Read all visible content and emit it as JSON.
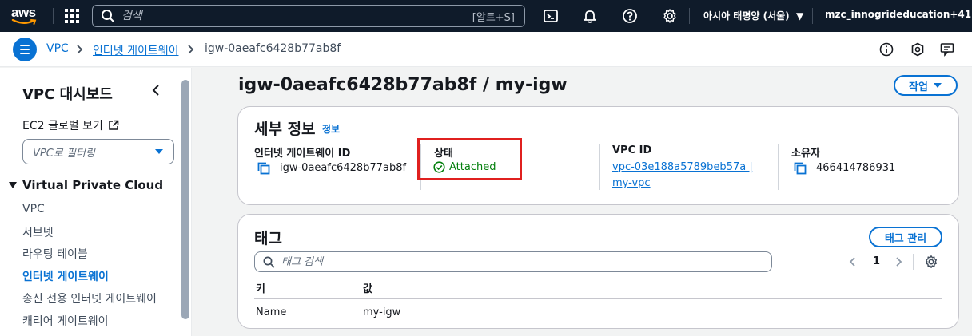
{
  "topnav": {
    "logo": "aws",
    "search_placeholder": "검색",
    "search_shortcut": "[알트+S]",
    "icons": [
      "apps-grid-icon",
      "cloudshell-icon",
      "bell-icon",
      "help-icon",
      "gear-icon"
    ],
    "region": "아시아 태평양 (서울)",
    "account": "mzc_innogrideducation+41"
  },
  "breadcrumb": {
    "items": [
      "VPC",
      "인터넷 게이트웨이",
      "igw-0aeafc6428b77ab8f"
    ],
    "right_icons": [
      "info-circle-icon",
      "hexagon-icon",
      "feedback-icon"
    ]
  },
  "sidebar": {
    "title": "VPC 대시보드",
    "ec2_global_view": "EC2 글로벌 보기",
    "filter_placeholder": "VPC로 필터링",
    "section": "Virtual Private Cloud",
    "items": [
      "VPC",
      "서브넷",
      "라우팅 테이블",
      "인터넷 게이트웨이",
      "송신 전용 인터넷 게이트웨이",
      "캐리어 게이트웨이"
    ],
    "active_item": "인터넷 게이트웨이"
  },
  "main": {
    "title": "igw-0aeafc6428b77ab8f / my-igw",
    "action_button": "작업",
    "details": {
      "title": "세부 정보",
      "info": "정보",
      "igw_id_label": "인터넷 게이트웨이 ID",
      "igw_id_value": "igw-0aeafc6428b77ab8f",
      "state_label": "상태",
      "state_value": "Attached",
      "vpc_id_label": "VPC ID",
      "vpc_id_line1": "vpc-03e188a5789beb57a |",
      "vpc_id_line2": "my-vpc",
      "owner_label": "소유자",
      "owner_value": "466414786931"
    },
    "tags": {
      "title": "태그",
      "manage_button": "태그 관리",
      "search_placeholder": "태그 검색",
      "page": "1",
      "columns": [
        "키",
        "값"
      ],
      "rows": [
        {
          "key": "Name",
          "value": "my-igw"
        }
      ]
    }
  },
  "colors": {
    "nav_bg": "#0f1b2a",
    "link": "#0972d3",
    "success": "#037f0c",
    "highlight": "#e0201f"
  }
}
